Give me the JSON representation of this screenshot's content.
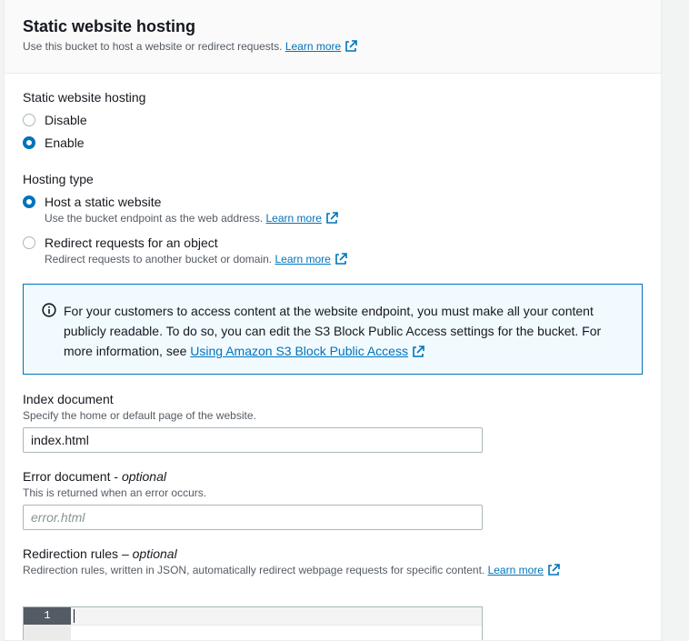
{
  "header": {
    "title": "Static website hosting",
    "description": "Use this bucket to host a website or redirect requests.",
    "learn_more": "Learn more"
  },
  "hosting": {
    "label": "Static website hosting",
    "options": [
      {
        "label": "Disable",
        "selected": false
      },
      {
        "label": "Enable",
        "selected": true
      }
    ]
  },
  "hosting_type": {
    "label": "Hosting type",
    "options": [
      {
        "label": "Host a static website",
        "description": "Use the bucket endpoint as the web address.",
        "learn_more": "Learn more",
        "selected": true
      },
      {
        "label": "Redirect requests for an object",
        "description": "Redirect requests to another bucket or domain.",
        "learn_more": "Learn more",
        "selected": false
      }
    ]
  },
  "info_alert": {
    "text": "For your customers to access content at the website endpoint, you must make all your content publicly readable. To do so, you can edit the S3 Block Public Access settings for the bucket. For more information, see",
    "link": "Using Amazon S3 Block Public Access",
    "icon": "info-icon"
  },
  "index_document": {
    "label": "Index document",
    "description": "Specify the home or default page of the website.",
    "value": "index.html"
  },
  "error_document": {
    "label": "Error document",
    "optional": "optional",
    "description": "This is returned when an error occurs.",
    "placeholder": "error.html"
  },
  "redirection_rules": {
    "label": "Redirection rules",
    "optional": "optional",
    "description": "Redirection rules, written in JSON, automatically redirect webpage requests for specific content.",
    "learn_more": "Learn more",
    "line_number": "1"
  },
  "colors": {
    "accent": "#0073bb",
    "info_background": "#f1faff",
    "text": "#16191f",
    "muted": "#545b64"
  }
}
